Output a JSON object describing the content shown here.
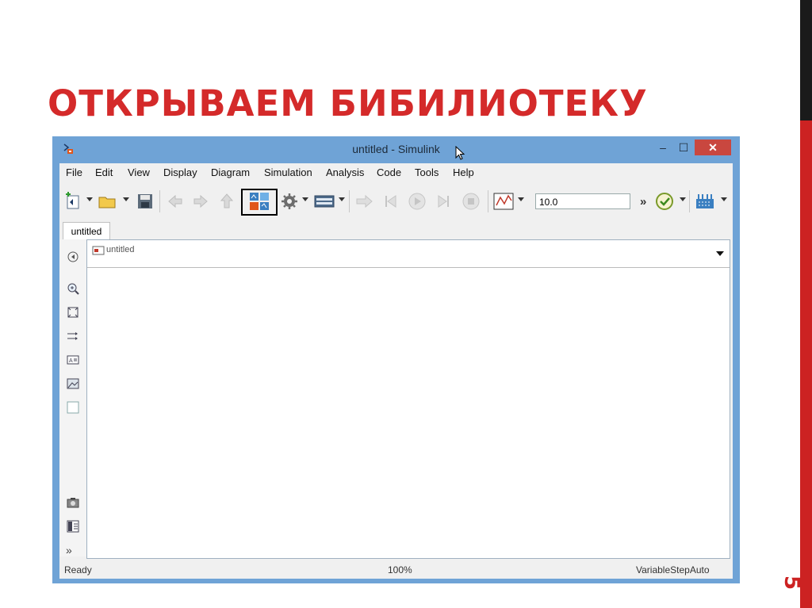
{
  "slide": {
    "title": "ОТКРЫВАЕМ БИБИЛИОТЕКУ",
    "page_number": "5",
    "accent_color": "#d42a2a"
  },
  "window": {
    "title": "untitled - Simulink",
    "min_symbol": "‒",
    "max_symbol": "☐",
    "close_symbol": "✕"
  },
  "menu": [
    "File",
    "Edit",
    "View",
    "Display",
    "Diagram",
    "Simulation",
    "Analysis",
    "Code",
    "Tools",
    "Help"
  ],
  "toolbar": {
    "stop_time": "10.0",
    "more_symbol": "»",
    "icons": [
      "new-model-icon",
      "open-icon",
      "save-icon",
      "back-icon",
      "forward-icon",
      "up-icon",
      "library-browser-icon",
      "model-config-icon",
      "model-explorer-icon",
      "step-back-icon",
      "run-icon",
      "step-forward-icon",
      "stop-icon",
      "scope-icon",
      "model-advisor-icon",
      "build-icon"
    ]
  },
  "tab": {
    "label": "untitled"
  },
  "address": {
    "text": "untitled"
  },
  "status": {
    "ready": "Ready",
    "zoom": "100%",
    "solver": "VariableStepAuto"
  }
}
